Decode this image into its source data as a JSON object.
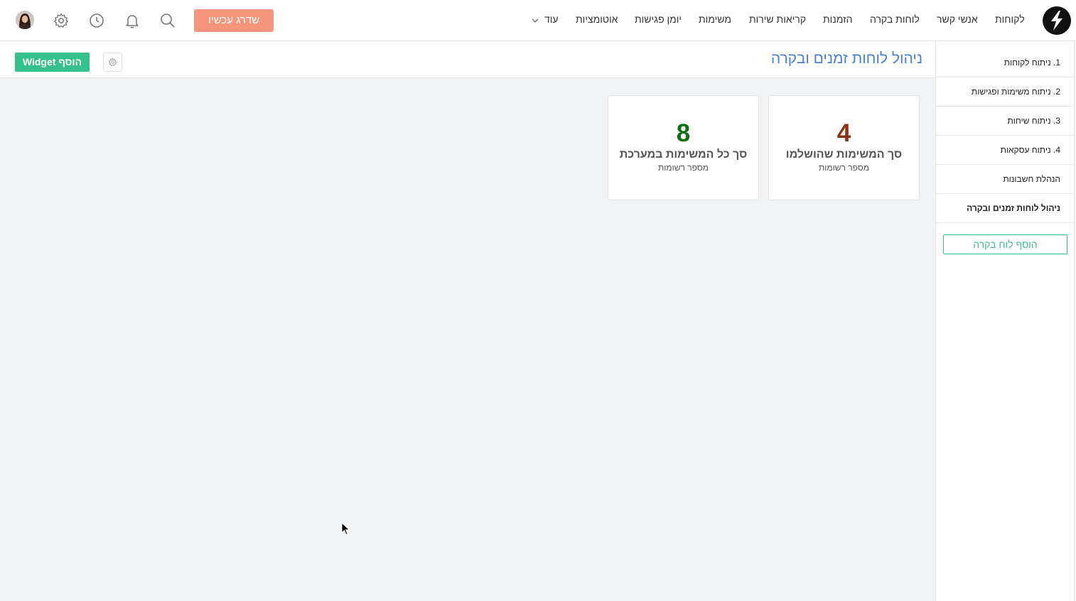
{
  "nav": {
    "items": [
      "לקוחות",
      "אנשי קשר",
      "לוחות בקרה",
      "הזמנות",
      "קריאות שירות",
      "משימות",
      "יומן פגישות",
      "אוטומציות",
      "עוד"
    ],
    "upgrade_label": "שדרג עכשיו"
  },
  "icons": {
    "logo": "brand-logo-icon",
    "search": "search-icon",
    "notifications": "bell-icon",
    "history": "clock-icon",
    "settings": "gear-icon",
    "avatar": "user-avatar"
  },
  "sidebar": {
    "items": [
      {
        "label": "1. ניתוח לקוחות",
        "active": false
      },
      {
        "label": "2. ניתוח משימות ופגישות",
        "active": false
      },
      {
        "label": "3. ניתוח שיחות",
        "active": false
      },
      {
        "label": "4. ניתוח עסקאות",
        "active": false
      },
      {
        "label": "הנהלת חשבונות",
        "active": false
      },
      {
        "label": "ניהול לוחות זמנים ובקרה",
        "active": true
      }
    ],
    "add_board_label": "הוסף לוח בקרה"
  },
  "header": {
    "title": "ניהול לוחות זמנים ובקרה",
    "add_widget_label": "הוסף Widget"
  },
  "widgets": [
    {
      "value": "4",
      "title": "סך המשימות שהושלמו",
      "subtitle": "מספר רשומות",
      "color": "#8b3216"
    },
    {
      "value": "8",
      "title": "סך כל המשימות במערכת",
      "subtitle": "מספר רשומות",
      "color": "#0f6e12"
    }
  ],
  "colors": {
    "accent_green": "#35c08d",
    "upgrade_orange": "#f7957c",
    "title_blue": "#4a7fd6"
  }
}
